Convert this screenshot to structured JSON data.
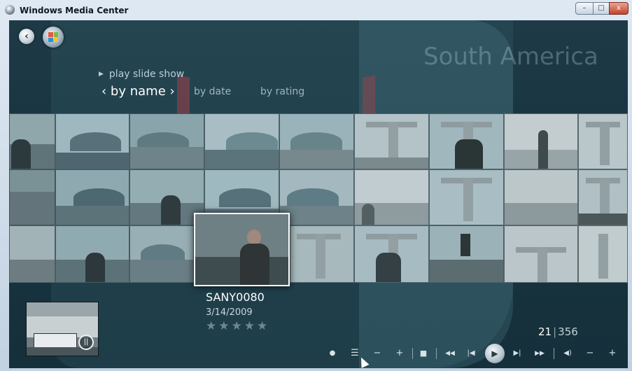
{
  "window": {
    "title": "Windows Media Center",
    "minimize_label": "–",
    "maximize_label": "□",
    "close_label": "x"
  },
  "nav": {
    "back_label": "‹"
  },
  "page": {
    "heading": "South America"
  },
  "menu": {
    "slide_show_label": "play slide show"
  },
  "sort": {
    "by_name_label": "‹ by name ›",
    "by_date_label": "by date",
    "by_rating_label": "by rating"
  },
  "selected": {
    "name": "SANY0080",
    "date": "3/14/2009",
    "stars": "★★★★★"
  },
  "counter": {
    "current": "21",
    "separator": "|",
    "total": "356"
  },
  "transport": {
    "record_icon": "●",
    "list_icon": "☰",
    "minus1_icon": "−",
    "plus1_icon": "+",
    "stop_icon": "■",
    "rewind_icon": "◀◀",
    "prev_icon": "|◀",
    "play_icon": "▶",
    "next_icon": "▶|",
    "ffwd_icon": "▶▶",
    "volume_icon": "◀)",
    "vol_down_icon": "−",
    "vol_up_icon": "+"
  },
  "mini_player": {
    "pause_icon": "||"
  },
  "colors": {
    "tile_tint": "#7fa4ad",
    "text_primary": "#ffffff",
    "accent_red": "#a3404a"
  }
}
